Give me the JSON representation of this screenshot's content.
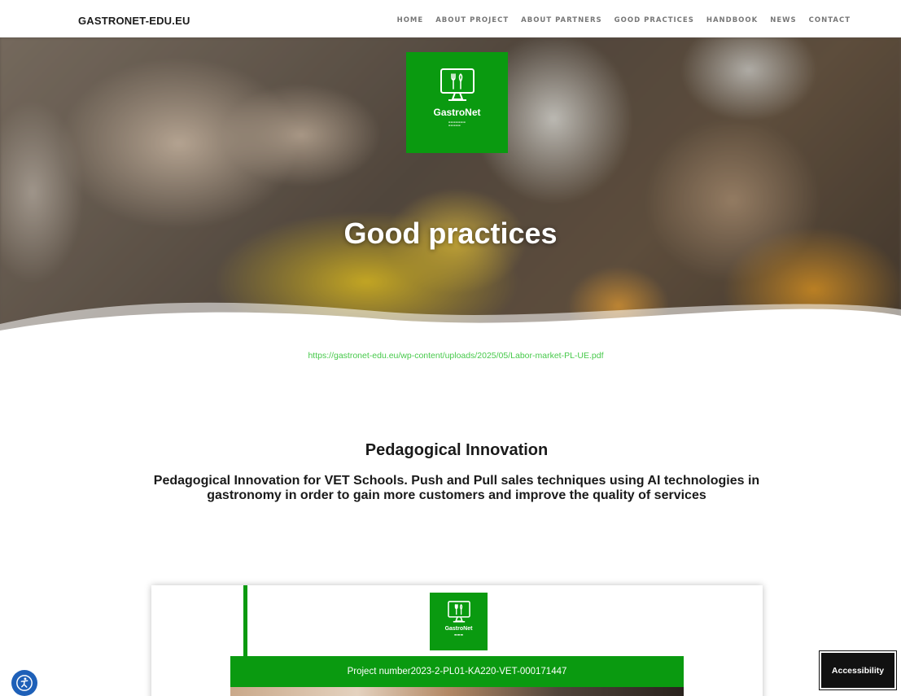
{
  "header": {
    "brand": "GASTRONET-EDU.EU",
    "nav": {
      "home": "HOME",
      "about_project": "ABOUT PROJECT",
      "about_partners": "ABOUT PARTNERS",
      "good_practices": "GOOD PRACTICES",
      "handbook": "HANDBOOK",
      "news": "NEWS",
      "contact": "CONTACT"
    }
  },
  "hero": {
    "logo_text": "GastroNet",
    "title": "Good practices"
  },
  "content": {
    "pdf_link": "https://gastronet-edu.eu/wp-content/uploads/2025/05/Labor-market-PL-UE.pdf",
    "section_title": "Pedagogical Innovation",
    "section_description": "Pedagogical Innovation for VET Schools. Push and Pull sales techniques using AI technologies in gastronomy in order to gain more customers and improve the quality of services"
  },
  "document_preview": {
    "logo_text": "GastroNet",
    "project_label": "Project number",
    "project_number": "2023-2-PL01-KA220-VET-000171447"
  },
  "widgets": {
    "accessibility_label": "Accessibility"
  },
  "colors": {
    "brand_green": "#0a9a10",
    "link_green": "#46c94a",
    "nav_text": "#777777",
    "accessibility_blue": "#1e60b8"
  }
}
